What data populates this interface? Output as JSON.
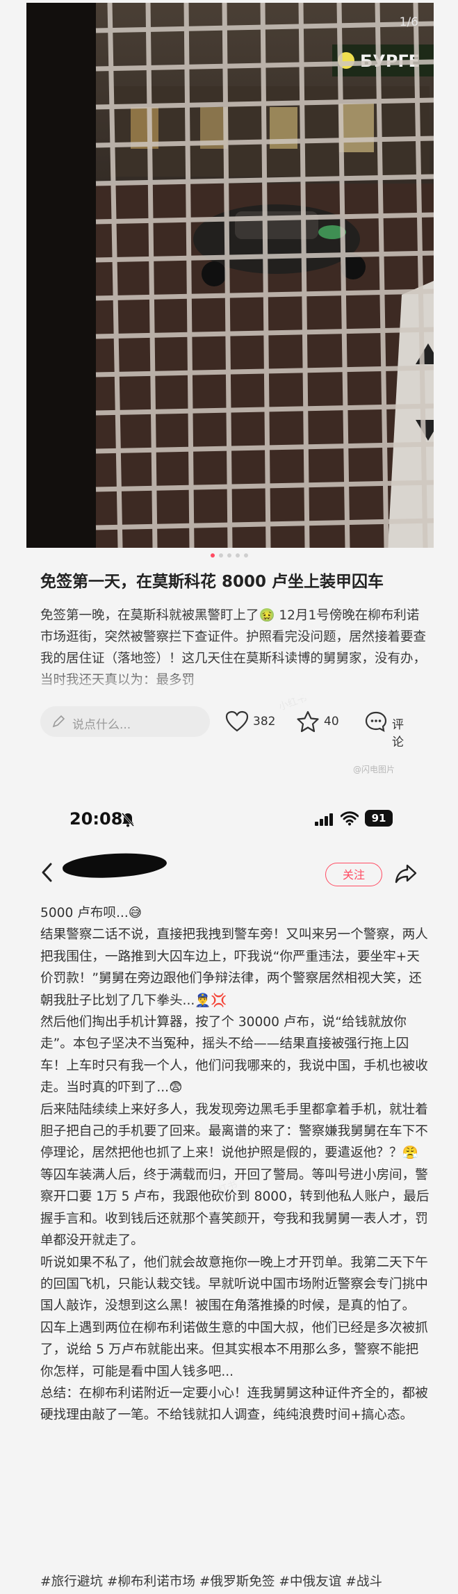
{
  "photo": {
    "counter": "1/6",
    "sign_text": "БУРГЕ",
    "dots_count": 5,
    "active_dot": 0
  },
  "post1": {
    "title": "免签第一天，在莫斯科花 8000 卢坐上装甲囚车",
    "body": "免签第一晚，在莫斯科就被黑警盯上了🤢 12月1号傍晚在柳布利诺市场逛街，突然被警察拦下查证件。护照看完没问题，居然接着要查我的居住证（落地签）！这几天住在莫斯科读博的舅舅家，没有办，当时我还天真以为：最多罚"
  },
  "actions": {
    "comment_placeholder": "说点什么...",
    "likes": "382",
    "favorites": "40",
    "comment_label": "评论"
  },
  "watermark": "@闪电图片",
  "status_bar": {
    "time": "20:08",
    "battery": "91"
  },
  "header": {
    "follow_label": "关注"
  },
  "post2": {
    "paragraphs": [
      "5000 卢布呗...😅",
      "结果警察二话不说，直接把我拽到警车旁！又叫来另一个警察，两人把我围住，一路推到大囚车边上，吓我说“你严重违法，要坐牢+天价罚款！”舅舅在旁边跟他们争辩法律，两个警察居然相视大笑，还朝我肚子比划了几下拳头...👮‍♂️💢",
      "然后他们掏出手机计算器，按了个 30000 卢布，说“给钱就放你走”。本包子坚决不当冤种，摇头不给——结果直接被强行拖上囚车！上车时只有我一个人，他们问我哪来的，我说中国，手机也被收走。当时真的吓到了...😨",
      "后来陆陆续续上来好多人，我发现旁边黑毛手里都拿着手机，就壮着胆子把自己的手机要了回来。最离谱的来了：警察嫌我舅舅在车下不停理论，居然把他也抓了上来！说他护照是假的，要遣返他？？😤",
      "等囚车装满人后，终于满载而归，开回了警局。等叫号进小房间，警察开口要 1万 5 卢布，我跟他砍价到 8000，转到他私人账户，最后握手言和。收到钱后还就那个喜笑颜开，夸我和我舅舅一表人才，罚单都没开就走了。",
      "听说如果不私了，他们就会故意拖你一晚上才开罚单。我第二天下午的回国飞机，只能认栽交钱。早就听说中国市场附近警察会专门挑中国人敲诈，没想到这么黑！被围在角落推搡的时候，是真的怕了。",
      "囚车上遇到两位在柳布利诺做生意的中国大叔，他们已经是多次被抓了，说给 5 万卢布就能出来。但其实根本不用那么多，警察不能把你怎样，可能是看中国人钱多吧...",
      "总结：在柳布利诺附近一定要小心！连我舅舅这种证件齐全的，都被硬找理由敲了一笔。不给钱就扣人调查，纯纯浪费时间+搞心态。"
    ],
    "tags": "#旅行避坑 #柳布利诺市场 #俄罗斯免签 #中俄友谊 #战斗"
  },
  "colors": {
    "accent": "#ff4b62",
    "background": "#f4f4f4",
    "text": "#333333"
  }
}
